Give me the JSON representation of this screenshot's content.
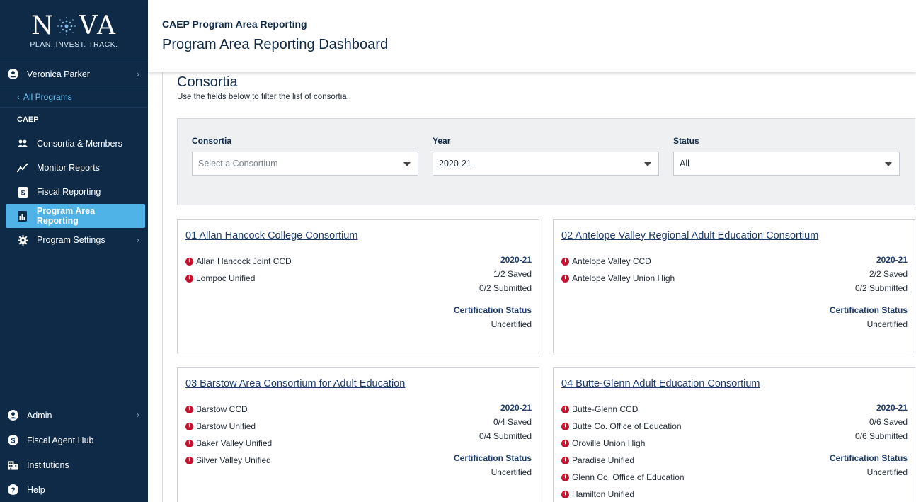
{
  "brand": {
    "name_left": "N",
    "name_right": "VA",
    "tagline": "PLAN. INVEST. TRACK."
  },
  "sidebar": {
    "user": "Veronica Parker",
    "back": "All Programs",
    "section": "CAEP",
    "items": [
      {
        "label": "Consortia & Members",
        "icon": "people-icon"
      },
      {
        "label": "Monitor Reports",
        "icon": "trend-icon"
      },
      {
        "label": "Fiscal Reporting",
        "icon": "dollar-doc-icon"
      },
      {
        "label": "Program Area Reporting",
        "icon": "bar-chart-icon",
        "active": true
      },
      {
        "label": "Program Settings",
        "icon": "gear-icon"
      }
    ],
    "bottom": [
      {
        "label": "Admin",
        "icon": "admin-user-icon"
      },
      {
        "label": "Fiscal Agent Hub",
        "icon": "dollar-circle-icon"
      },
      {
        "label": "Institutions",
        "icon": "building-icon"
      },
      {
        "label": "Help",
        "icon": "question-icon"
      }
    ]
  },
  "header": {
    "crumb": "CAEP Program Area Reporting",
    "title": "Program Area Reporting Dashboard"
  },
  "main": {
    "heading": "Consortia",
    "help": "Use the fields below to filter the list of consortia.",
    "filters": {
      "consortia": {
        "label": "Consortia",
        "placeholder": "Select a Consortium"
      },
      "year": {
        "label": "Year",
        "value": "2020-21"
      },
      "status": {
        "label": "Status",
        "value": "All"
      }
    },
    "cards": [
      {
        "title": "01 Allan Hancock College Consortium",
        "members": [
          "Allan Hancock Joint CCD",
          "Lompoc Unified"
        ],
        "year": "2020-21",
        "saved": "1/2 Saved",
        "submitted": "0/2 Submitted",
        "cert_label": "Certification Status",
        "cert_value": "Uncertified"
      },
      {
        "title": "02 Antelope Valley Regional Adult Education Consortium",
        "members": [
          "Antelope Valley CCD",
          "Antelope Valley Union High"
        ],
        "year": "2020-21",
        "saved": "2/2 Saved",
        "submitted": "0/2 Submitted",
        "cert_label": "Certification Status",
        "cert_value": "Uncertified"
      },
      {
        "title": "03 Barstow Area Consortium for Adult Education",
        "members": [
          "Barstow CCD",
          "Barstow Unified",
          "Baker Valley Unified",
          "Silver Valley Unified"
        ],
        "year": "2020-21",
        "saved": "0/4 Saved",
        "submitted": "0/4 Submitted",
        "cert_label": "Certification Status",
        "cert_value": "Uncertified"
      },
      {
        "title": "04 Butte-Glenn Adult Education Consortium",
        "members": [
          "Butte-Glenn CCD",
          "Butte Co. Office of Education",
          "Oroville Union High",
          "Paradise Unified",
          "Glenn Co. Office of Education",
          "Hamilton Unified"
        ],
        "year": "2020-21",
        "saved": "0/6 Saved",
        "submitted": "0/6 Submitted",
        "cert_label": "Certification Status",
        "cert_value": "Uncertified"
      }
    ]
  },
  "colors": {
    "sidebar": "#0e2a47",
    "active": "#4fb3e8",
    "link": "#1d3b6e",
    "alert": "#c8102e"
  }
}
